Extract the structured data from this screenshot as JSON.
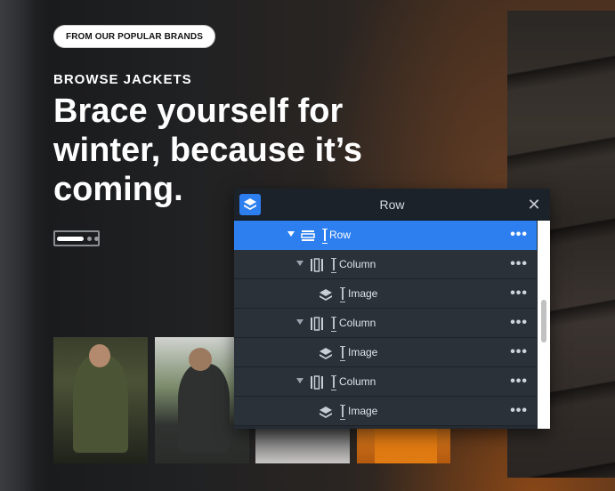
{
  "hero": {
    "badge": "FROM OUR POPULAR BRANDS",
    "eyebrow": "BROWSE JACKETS",
    "headline": "Brace yourself for winter, because it’s coming."
  },
  "panel": {
    "title": "Row",
    "close_label": "✕",
    "rows": [
      {
        "label": "Row",
        "type": "row",
        "icon": "row-icon",
        "expanded": true,
        "selected": true
      },
      {
        "label": "Column",
        "type": "column",
        "icon": "column-icon",
        "expanded": true
      },
      {
        "label": "Image",
        "type": "module",
        "icon": "layers-icon"
      },
      {
        "label": "Column",
        "type": "column",
        "icon": "column-icon",
        "expanded": true
      },
      {
        "label": "Image",
        "type": "module",
        "icon": "layers-icon"
      },
      {
        "label": "Column",
        "type": "column",
        "icon": "column-icon",
        "expanded": true
      },
      {
        "label": "Image",
        "type": "module",
        "icon": "layers-icon"
      }
    ],
    "more_label": "•••"
  },
  "colors": {
    "accent": "#2d7ff0",
    "panel_bg": "#242b33"
  }
}
